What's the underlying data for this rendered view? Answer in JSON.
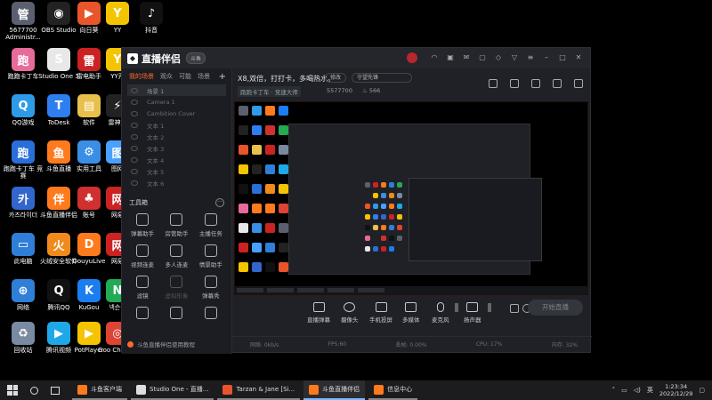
{
  "desktop_icons": [
    {
      "label": "5677700 Administr...",
      "color": "#5a6070",
      "glyph": "管"
    },
    {
      "label": "OBS Studio",
      "color": "#222222",
      "glyph": "◉"
    },
    {
      "label": "向日葵",
      "color": "#e8552b",
      "glyph": "▶"
    },
    {
      "label": "YY",
      "color": "#f5c400",
      "glyph": "Y"
    },
    {
      "label": "抖音",
      "color": "#111111",
      "glyph": "♪"
    },
    {
      "label": "跑跑卡丁车",
      "color": "#e66a9a",
      "glyph": "跑"
    },
    {
      "label": "Studio One 3",
      "color": "#e8e8e8",
      "glyph": "S"
    },
    {
      "label": "雷电助手",
      "color": "#cc2222",
      "glyph": "雷"
    },
    {
      "label": "YY开",
      "color": "#f5c400",
      "glyph": "Y"
    },
    {
      "label": "QQ游戏",
      "color": "#2f9be8",
      "glyph": "Q"
    },
    {
      "label": "ToDesk",
      "color": "#2e7ef0",
      "glyph": "T"
    },
    {
      "label": "软件",
      "color": "#e8c04c",
      "glyph": "▤"
    },
    {
      "label": "雷神加",
      "color": "#222222",
      "glyph": "⚡"
    },
    {
      "label": "跑跑卡丁车 竞赛",
      "color": "#2a6ed8",
      "glyph": "跑"
    },
    {
      "label": "斗鱼直播",
      "color": "#ff7a1c",
      "glyph": "鱼"
    },
    {
      "label": "实用工具",
      "color": "#3a8ee6",
      "glyph": "⚙"
    },
    {
      "label": "图网",
      "color": "#4aa0ff",
      "glyph": "图"
    },
    {
      "label": "카즈라이더",
      "color": "#3366cc",
      "glyph": "카"
    },
    {
      "label": "斗鱼直播伴侣",
      "color": "#ff7a1c",
      "glyph": "伴"
    },
    {
      "label": "账号",
      "color": "#d03030",
      "glyph": "♣"
    },
    {
      "label": "网易",
      "color": "#cc2222",
      "glyph": "网"
    },
    {
      "label": "此电脑",
      "color": "#2f7fd8",
      "glyph": "▭"
    },
    {
      "label": "火绒安全软件",
      "color": "#f08a1c",
      "glyph": "火"
    },
    {
      "label": "DouyuLive",
      "color": "#ff7a1c",
      "glyph": "D"
    },
    {
      "label": "网易",
      "color": "#cc2222",
      "glyph": "网"
    },
    {
      "label": "网络",
      "color": "#2f7fd8",
      "glyph": "⊕"
    },
    {
      "label": "腾讯QQ",
      "color": "#111111",
      "glyph": "Q"
    },
    {
      "label": "KuGou",
      "color": "#1a7ef0",
      "glyph": "K"
    },
    {
      "label": "넥슨플",
      "color": "#22aa55",
      "glyph": "N"
    },
    {
      "label": "回收站",
      "color": "#7a8aa0",
      "glyph": "♻"
    },
    {
      "label": "腾讯视频",
      "color": "#1ea8e8",
      "glyph": "▶"
    },
    {
      "label": "PotPlayer",
      "color": "#f5c400",
      "glyph": "▶"
    },
    {
      "label": "Goo Chrome",
      "color": "#dd4433",
      "glyph": "◎"
    }
  ],
  "app": {
    "title": "直播伴侣",
    "version_badge": "斗鱼",
    "tabs": [
      "我的场景",
      "观众",
      "可能",
      "场景"
    ],
    "scenes": [
      "场景 1",
      "Camera 1",
      "Cambition Cover",
      "文本 1",
      "文本 2",
      "文本 3",
      "文本 4",
      "文本 5",
      "文本 6"
    ],
    "toolbox_title": "工具箱",
    "tools": [
      {
        "label": "弹幕助手",
        "dim": false
      },
      {
        "label": "房管助手",
        "dim": false
      },
      {
        "label": "主播任务",
        "dim": false
      },
      {
        "label": "视频连麦",
        "dim": false
      },
      {
        "label": "多人连麦",
        "dim": false
      },
      {
        "label": "情景助手",
        "dim": false
      },
      {
        "label": "滤镜",
        "dim": false
      },
      {
        "label": "虚拟形象",
        "dim": true
      },
      {
        "label": "弹幕秀",
        "dim": false
      },
      {
        "label": "",
        "dim": false
      },
      {
        "label": "",
        "dim": false
      },
      {
        "label": "",
        "dim": false
      }
    ],
    "help_link": "斗鱼直播伴侣使用教程",
    "room": {
      "title": "X8,双倍，打打卡，多喝热水。",
      "edit_label": "修改",
      "notice_label": "守望先锋",
      "category": "跑跑卡丁车 · 竞速大师",
      "room_id": "5577700",
      "heat": "566"
    },
    "controls": [
      "直播弹幕",
      "摄像头",
      "手机投屏",
      "多媒体",
      "麦克风",
      "扬声器"
    ],
    "golive_label": "开始直播",
    "status": [
      "网络: 0kb/s",
      "FPS:60",
      "丢帧: 0.00%",
      "CPU: 17%",
      "内存: 32%"
    ]
  },
  "taskbar": {
    "apps": [
      {
        "label": "斗鱼客户端",
        "color": "#ff7a1c",
        "active": false
      },
      {
        "label": "Studio One - 直播...",
        "color": "#dddddd",
        "active": false
      },
      {
        "label": "Tarzan & Jane [Si...",
        "color": "#e8552b",
        "active": false
      },
      {
        "label": "斗鱼直播伴侣",
        "color": "#ff7a1c",
        "active": true
      },
      {
        "label": "信息中心",
        "color": "#ff7a1c",
        "active": false
      }
    ],
    "time": "1:23:34",
    "date": "2022/12/29",
    "input_method": "英"
  }
}
